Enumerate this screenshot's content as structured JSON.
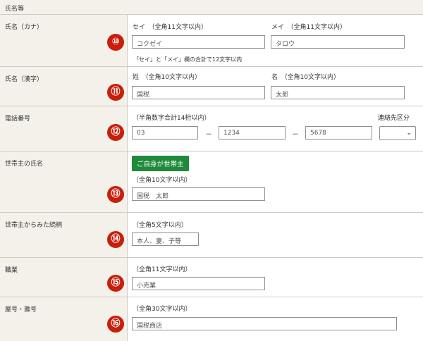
{
  "section_title": "氏名等",
  "colors": {
    "label_bg": "#f3f1ea",
    "badge": "#c81e0c",
    "button": "#1e8a3a"
  },
  "rows": {
    "kana": {
      "label": "氏名（カナ）",
      "badge": "⑩",
      "sei_hint": "セイ　（全角11文字以内）",
      "mei_hint": "メイ　（全角11文字以内）",
      "sei_placeholder": "コクゼイ",
      "mei_placeholder": "タロウ",
      "note": "「セイ」と「メイ」欄の合計で12文字以内"
    },
    "kanji": {
      "label": "氏名（漢字）",
      "badge": "⑪",
      "sei_hint": "姓　（全角10文字以内）",
      "mei_hint": "名　（全角10文字以内）",
      "sei_placeholder": "国税",
      "mei_placeholder": "太郎"
    },
    "phone": {
      "label": "電話番号",
      "badge": "⑫",
      "hint": "（半角数字合計14桁以内）",
      "contact_label": "連絡先区分",
      "part1_placeholder": "03",
      "part2_placeholder": "1234",
      "part3_placeholder": "5678",
      "sep": "－",
      "select_value": ""
    },
    "householder": {
      "label": "世帯主の氏名",
      "badge": "⑬",
      "button": "ご自身が世帯主",
      "hint": "（全角10文字以内）",
      "placeholder": "国税　太郎"
    },
    "relation": {
      "label": "世帯主からみた続柄",
      "badge": "⑭",
      "hint": "（全角5文字以内）",
      "placeholder": "本人、妻、子等"
    },
    "occupation": {
      "label": "職業",
      "badge": "⑮",
      "hint": "（全角11文字以内）",
      "placeholder": "小売業"
    },
    "trade_name": {
      "label": "屋号・雅号",
      "badge": "⑯",
      "hint": "（全角30文字以内）",
      "placeholder": "国税商店"
    }
  }
}
